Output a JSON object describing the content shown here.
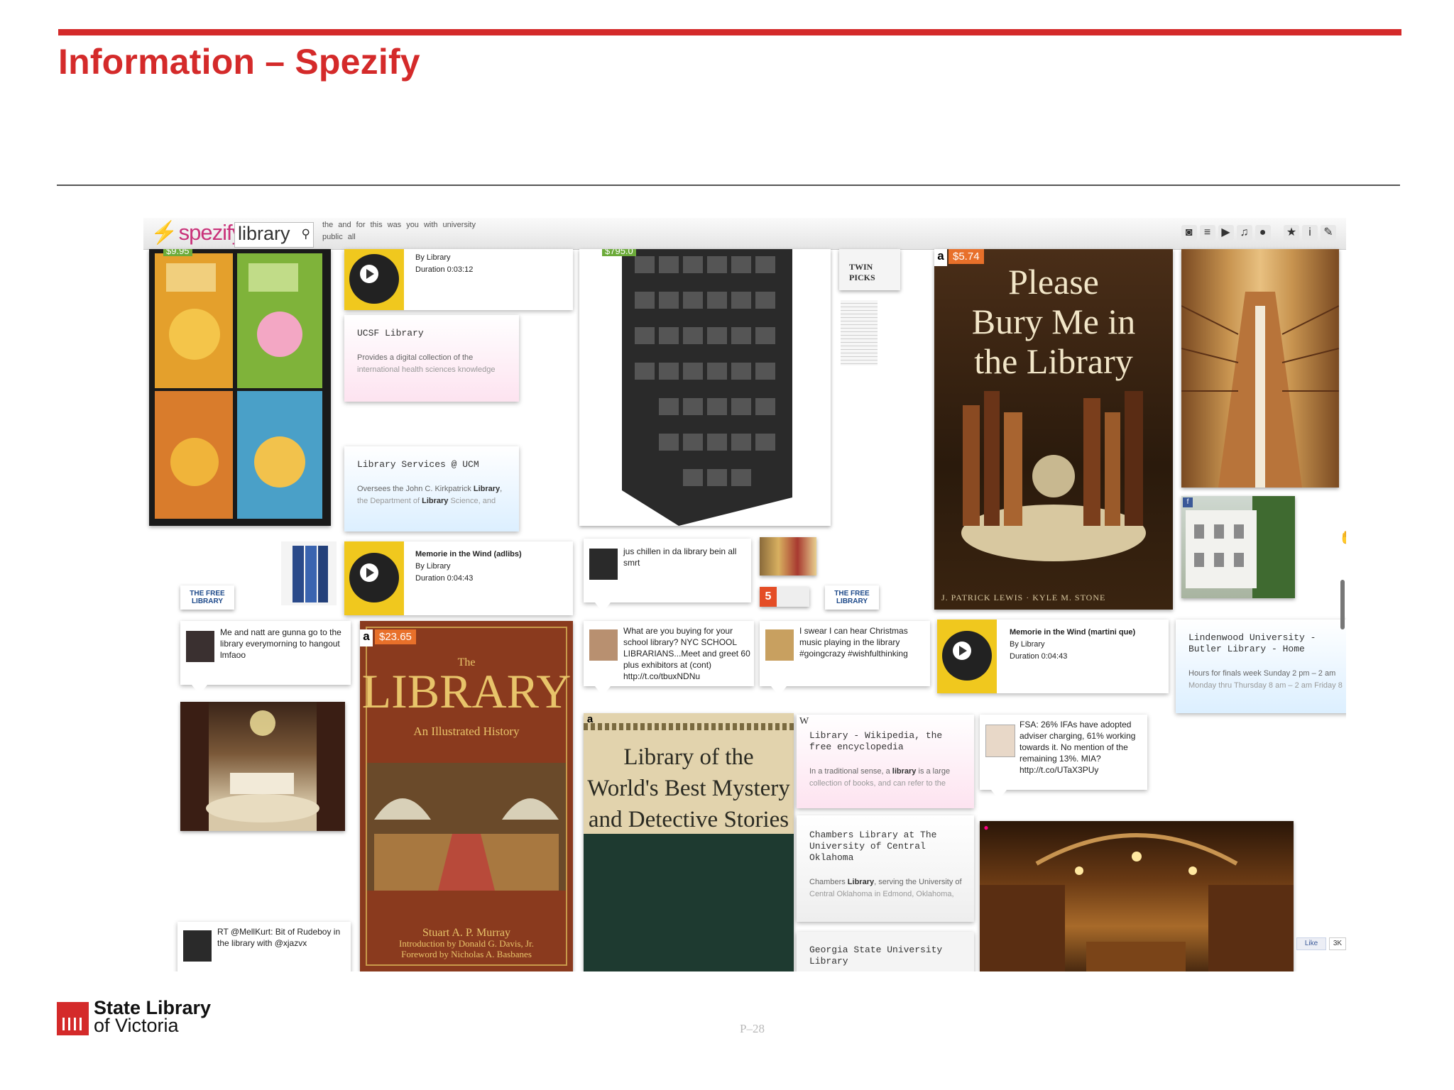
{
  "slide": {
    "title": "Information – Spezify",
    "page_number": "P–28",
    "logo_line1": "State Library",
    "logo_line2": "of Victoria",
    "accent_color": "#d42a2a"
  },
  "app": {
    "brand": "spezify",
    "search_value": "library",
    "suggestions": [
      "the",
      "and",
      "for",
      "this",
      "was",
      "you",
      "with",
      "university",
      "public",
      "all"
    ],
    "toolbar_icons": [
      "camera-icon",
      "list-icon",
      "video-icon",
      "music-icon",
      "speech-icon",
      "star-icon",
      "info-icon",
      "wrench-icon"
    ]
  },
  "tiles": {
    "pooh_price": "$9.95",
    "cabinet_price": "$795.0",
    "bury_price": "$5.74",
    "library_book_price": "$23.65",
    "twin_picks": "TWIN PICKS",
    "bury_title_1": "Please",
    "bury_title_2": "Bury Me in",
    "bury_title_3": "the Library",
    "bury_authors": "J. PATRICK LEWIS · KYLE M. STONE",
    "lib_book_small": "The",
    "lib_book_big": "LIBRARY",
    "lib_book_sub": "An Illustrated History",
    "lib_book_author1": "Stuart A. P. Murray",
    "lib_book_author2": "Introduction by Donald G. Davis, Jr.",
    "lib_book_author3": "Foreword by Nicholas A. Basbanes",
    "mystery_title_1": "Library of the",
    "mystery_title_2": "World's Best Mystery",
    "mystery_title_3": "and Detective Stories",
    "free_library_1": "THE FREE LIBRARY",
    "free_library_2": "THE FREE LIBRARY",
    "like_label": "Like",
    "like_count": "3K"
  },
  "mp3": [
    {
      "title": "",
      "by": "By Library",
      "duration": "Duration 0:03:12"
    },
    {
      "title": "Memorie in the Wind (adlibs)",
      "by": "By Library",
      "duration": "Duration 0:04:43"
    },
    {
      "title": "Memorie in the Wind (martini que)",
      "by": "By Library",
      "duration": "Duration 0:04:43"
    }
  ],
  "webcards": {
    "ucsf": {
      "title": "UCSF Library",
      "desc1": "Provides a digital collection of the",
      "desc2": "international health sciences knowledge"
    },
    "ucm": {
      "title": "Library Services @ UCM",
      "desc1_pre": "Oversees the John C. Kirkpatrick ",
      "desc1_bold": "Library",
      "desc1_post": ",",
      "desc2_pre": "the Department of ",
      "desc2_bold": "Library",
      "desc2_post": " Science, and"
    },
    "lindenwood": {
      "title1": "Lindenwood University -",
      "title2": "Butler Library - Home",
      "desc1": "Hours for finals week Sunday 2 pm – 2 am",
      "desc2": "Monday thru Thursday 8 am – 2 am Friday 8"
    },
    "wikipedia": {
      "title1": "Library - Wikipedia, the",
      "title2": "free encyclopedia",
      "desc1_pre": "In a traditional sense, a ",
      "desc1_bold": "library",
      "desc1_post": " is a large",
      "desc2": "collection of books, and can refer to the"
    },
    "chambers": {
      "title1": "Chambers Library at The",
      "title2": "University of Central",
      "title3": "Oklahoma",
      "desc1_pre": "Chambers ",
      "desc1_bold": "Library",
      "desc1_post": ", serving the University of",
      "desc2": "Central Oklahoma in Edmond, Oklahoma,"
    },
    "georgia": {
      "title1": "Georgia State University",
      "title2": "Library"
    }
  },
  "tweets": {
    "chillen": "jus chillen in da library bein all smrt",
    "gunna": "Me and natt are gunna go to the library everymorning to hangout lmfaoo",
    "nyc": "What are you buying for your school library? NYC SCHOOL LIBRARIANS...Meet and greet 60 plus exhibitors at (cont) http://t.co/tbuxNDNu",
    "christmas": "I swear I can hear Christmas music playing in the library #goingcrazy #wishfulthinking",
    "fsa": "FSA: 26% IFAs have adopted adviser charging, 61% working towards it. No mention of the remaining 13%. MIA? http://t.co/UTaX3PUy",
    "rudeboy": "RT @MellKurt: Bit of Rudeboy in the library with @xjazvx"
  },
  "colors": {
    "mp3_yellow": "#f0c81e",
    "price_orange": "#e8702a",
    "pink_card": "#fde3f0",
    "blue_card": "#dcefff",
    "brand_pink": "#c9327a"
  }
}
